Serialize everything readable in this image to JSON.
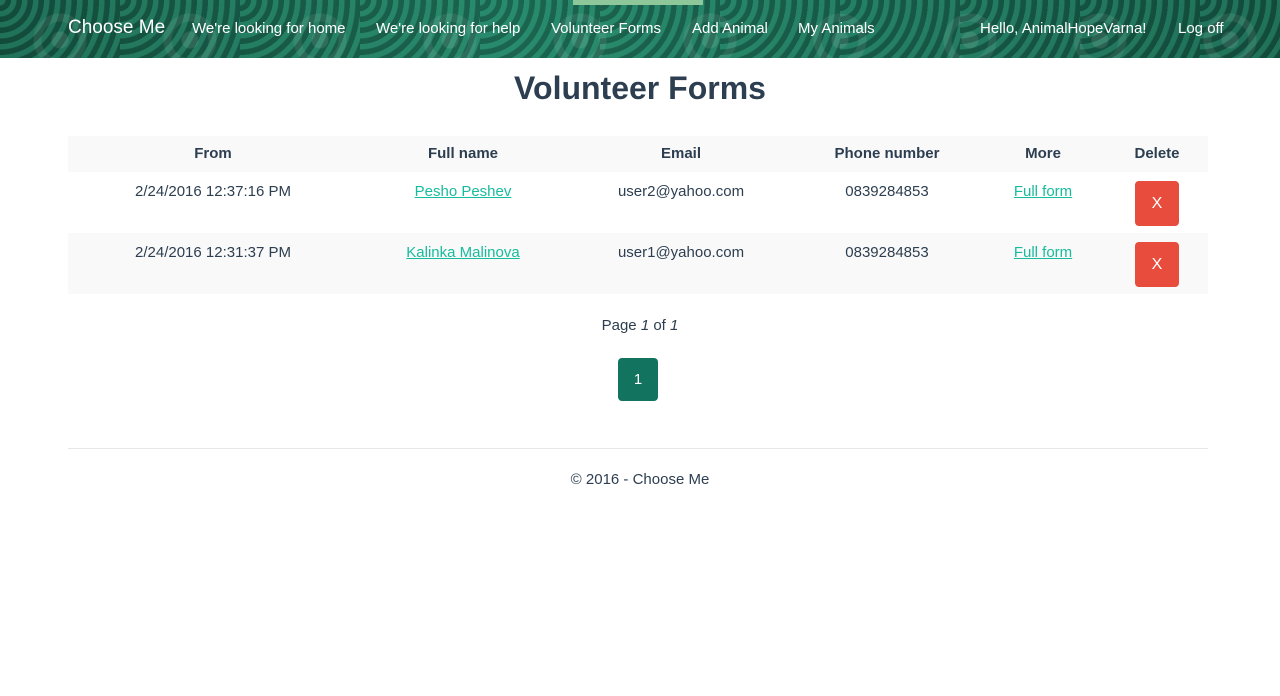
{
  "nav": {
    "brand": "Choose Me",
    "links": [
      "We're looking for home",
      "We're looking for help",
      "Volunteer Forms",
      "Add Animal",
      "My Animals"
    ],
    "greeting": "Hello, AnimalHopeVarna!",
    "logoff": "Log off"
  },
  "page": {
    "title": "Volunteer Forms"
  },
  "table": {
    "headers": [
      "From",
      "Full name",
      "Email",
      "Phone number",
      "More",
      "Delete"
    ],
    "rows": [
      {
        "from": "2/24/2016 12:37:16 PM",
        "name": "Pesho Peshev",
        "email": "user2@yahoo.com",
        "phone": "0839284853",
        "more": "Full form",
        "delete": "X"
      },
      {
        "from": "2/24/2016 12:31:37 PM",
        "name": "Kalinka Malinova",
        "email": "user1@yahoo.com",
        "phone": "0839284853",
        "more": "Full form",
        "delete": "X"
      }
    ]
  },
  "pagination": {
    "label": "Page",
    "current": "1",
    "of": "of",
    "total": "1",
    "pages": [
      "1"
    ]
  },
  "footer": {
    "text": "© 2016 - Choose Me"
  },
  "colors": {
    "accent": "#18bc9c",
    "danger": "#e74c3c",
    "page_active": "#12735f",
    "text": "#2c3e50"
  }
}
